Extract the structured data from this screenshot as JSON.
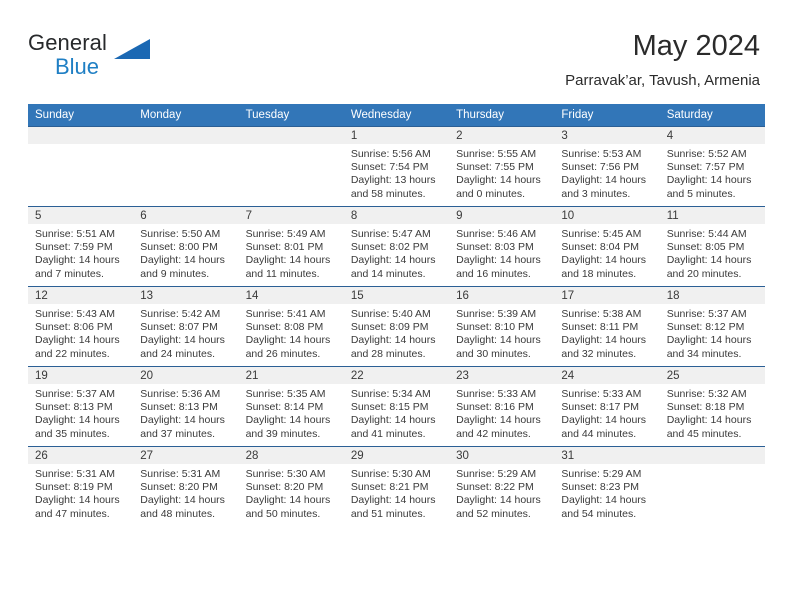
{
  "brand": {
    "name_part1": "General",
    "name_part2": "Blue",
    "logo_icon": "triangle-flag-icon"
  },
  "header": {
    "month_title": "May 2024",
    "location": "Parravak’ar, Tavush, Armenia"
  },
  "calendar": {
    "weekday_headers": [
      "Sunday",
      "Monday",
      "Tuesday",
      "Wednesday",
      "Thursday",
      "Friday",
      "Saturday"
    ],
    "colors": {
      "header_background": "#3276b8",
      "row_separator": "#2b5f95",
      "daynum_band": "#f0f0f0",
      "brand_blue": "#1f7fc4",
      "text": "#3a3a3a"
    },
    "weeks": [
      [
        {
          "empty": true
        },
        {
          "empty": true
        },
        {
          "empty": true
        },
        {
          "day": "1",
          "sunrise": "Sunrise: 5:56 AM",
          "sunset": "Sunset: 7:54 PM",
          "daylight_line1": "Daylight: 13 hours",
          "daylight_line2": "and 58 minutes."
        },
        {
          "day": "2",
          "sunrise": "Sunrise: 5:55 AM",
          "sunset": "Sunset: 7:55 PM",
          "daylight_line1": "Daylight: 14 hours",
          "daylight_line2": "and 0 minutes."
        },
        {
          "day": "3",
          "sunrise": "Sunrise: 5:53 AM",
          "sunset": "Sunset: 7:56 PM",
          "daylight_line1": "Daylight: 14 hours",
          "daylight_line2": "and 3 minutes."
        },
        {
          "day": "4",
          "sunrise": "Sunrise: 5:52 AM",
          "sunset": "Sunset: 7:57 PM",
          "daylight_line1": "Daylight: 14 hours",
          "daylight_line2": "and 5 minutes."
        }
      ],
      [
        {
          "day": "5",
          "sunrise": "Sunrise: 5:51 AM",
          "sunset": "Sunset: 7:59 PM",
          "daylight_line1": "Daylight: 14 hours",
          "daylight_line2": "and 7 minutes."
        },
        {
          "day": "6",
          "sunrise": "Sunrise: 5:50 AM",
          "sunset": "Sunset: 8:00 PM",
          "daylight_line1": "Daylight: 14 hours",
          "daylight_line2": "and 9 minutes."
        },
        {
          "day": "7",
          "sunrise": "Sunrise: 5:49 AM",
          "sunset": "Sunset: 8:01 PM",
          "daylight_line1": "Daylight: 14 hours",
          "daylight_line2": "and 11 minutes."
        },
        {
          "day": "8",
          "sunrise": "Sunrise: 5:47 AM",
          "sunset": "Sunset: 8:02 PM",
          "daylight_line1": "Daylight: 14 hours",
          "daylight_line2": "and 14 minutes."
        },
        {
          "day": "9",
          "sunrise": "Sunrise: 5:46 AM",
          "sunset": "Sunset: 8:03 PM",
          "daylight_line1": "Daylight: 14 hours",
          "daylight_line2": "and 16 minutes."
        },
        {
          "day": "10",
          "sunrise": "Sunrise: 5:45 AM",
          "sunset": "Sunset: 8:04 PM",
          "daylight_line1": "Daylight: 14 hours",
          "daylight_line2": "and 18 minutes."
        },
        {
          "day": "11",
          "sunrise": "Sunrise: 5:44 AM",
          "sunset": "Sunset: 8:05 PM",
          "daylight_line1": "Daylight: 14 hours",
          "daylight_line2": "and 20 minutes."
        }
      ],
      [
        {
          "day": "12",
          "sunrise": "Sunrise: 5:43 AM",
          "sunset": "Sunset: 8:06 PM",
          "daylight_line1": "Daylight: 14 hours",
          "daylight_line2": "and 22 minutes."
        },
        {
          "day": "13",
          "sunrise": "Sunrise: 5:42 AM",
          "sunset": "Sunset: 8:07 PM",
          "daylight_line1": "Daylight: 14 hours",
          "daylight_line2": "and 24 minutes."
        },
        {
          "day": "14",
          "sunrise": "Sunrise: 5:41 AM",
          "sunset": "Sunset: 8:08 PM",
          "daylight_line1": "Daylight: 14 hours",
          "daylight_line2": "and 26 minutes."
        },
        {
          "day": "15",
          "sunrise": "Sunrise: 5:40 AM",
          "sunset": "Sunset: 8:09 PM",
          "daylight_line1": "Daylight: 14 hours",
          "daylight_line2": "and 28 minutes."
        },
        {
          "day": "16",
          "sunrise": "Sunrise: 5:39 AM",
          "sunset": "Sunset: 8:10 PM",
          "daylight_line1": "Daylight: 14 hours",
          "daylight_line2": "and 30 minutes."
        },
        {
          "day": "17",
          "sunrise": "Sunrise: 5:38 AM",
          "sunset": "Sunset: 8:11 PM",
          "daylight_line1": "Daylight: 14 hours",
          "daylight_line2": "and 32 minutes."
        },
        {
          "day": "18",
          "sunrise": "Sunrise: 5:37 AM",
          "sunset": "Sunset: 8:12 PM",
          "daylight_line1": "Daylight: 14 hours",
          "daylight_line2": "and 34 minutes."
        }
      ],
      [
        {
          "day": "19",
          "sunrise": "Sunrise: 5:37 AM",
          "sunset": "Sunset: 8:13 PM",
          "daylight_line1": "Daylight: 14 hours",
          "daylight_line2": "and 35 minutes."
        },
        {
          "day": "20",
          "sunrise": "Sunrise: 5:36 AM",
          "sunset": "Sunset: 8:13 PM",
          "daylight_line1": "Daylight: 14 hours",
          "daylight_line2": "and 37 minutes."
        },
        {
          "day": "21",
          "sunrise": "Sunrise: 5:35 AM",
          "sunset": "Sunset: 8:14 PM",
          "daylight_line1": "Daylight: 14 hours",
          "daylight_line2": "and 39 minutes."
        },
        {
          "day": "22",
          "sunrise": "Sunrise: 5:34 AM",
          "sunset": "Sunset: 8:15 PM",
          "daylight_line1": "Daylight: 14 hours",
          "daylight_line2": "and 41 minutes."
        },
        {
          "day": "23",
          "sunrise": "Sunrise: 5:33 AM",
          "sunset": "Sunset: 8:16 PM",
          "daylight_line1": "Daylight: 14 hours",
          "daylight_line2": "and 42 minutes."
        },
        {
          "day": "24",
          "sunrise": "Sunrise: 5:33 AM",
          "sunset": "Sunset: 8:17 PM",
          "daylight_line1": "Daylight: 14 hours",
          "daylight_line2": "and 44 minutes."
        },
        {
          "day": "25",
          "sunrise": "Sunrise: 5:32 AM",
          "sunset": "Sunset: 8:18 PM",
          "daylight_line1": "Daylight: 14 hours",
          "daylight_line2": "and 45 minutes."
        }
      ],
      [
        {
          "day": "26",
          "sunrise": "Sunrise: 5:31 AM",
          "sunset": "Sunset: 8:19 PM",
          "daylight_line1": "Daylight: 14 hours",
          "daylight_line2": "and 47 minutes."
        },
        {
          "day": "27",
          "sunrise": "Sunrise: 5:31 AM",
          "sunset": "Sunset: 8:20 PM",
          "daylight_line1": "Daylight: 14 hours",
          "daylight_line2": "and 48 minutes."
        },
        {
          "day": "28",
          "sunrise": "Sunrise: 5:30 AM",
          "sunset": "Sunset: 8:20 PM",
          "daylight_line1": "Daylight: 14 hours",
          "daylight_line2": "and 50 minutes."
        },
        {
          "day": "29",
          "sunrise": "Sunrise: 5:30 AM",
          "sunset": "Sunset: 8:21 PM",
          "daylight_line1": "Daylight: 14 hours",
          "daylight_line2": "and 51 minutes."
        },
        {
          "day": "30",
          "sunrise": "Sunrise: 5:29 AM",
          "sunset": "Sunset: 8:22 PM",
          "daylight_line1": "Daylight: 14 hours",
          "daylight_line2": "and 52 minutes."
        },
        {
          "day": "31",
          "sunrise": "Sunrise: 5:29 AM",
          "sunset": "Sunset: 8:23 PM",
          "daylight_line1": "Daylight: 14 hours",
          "daylight_line2": "and 54 minutes."
        },
        {
          "empty": true
        }
      ]
    ]
  }
}
